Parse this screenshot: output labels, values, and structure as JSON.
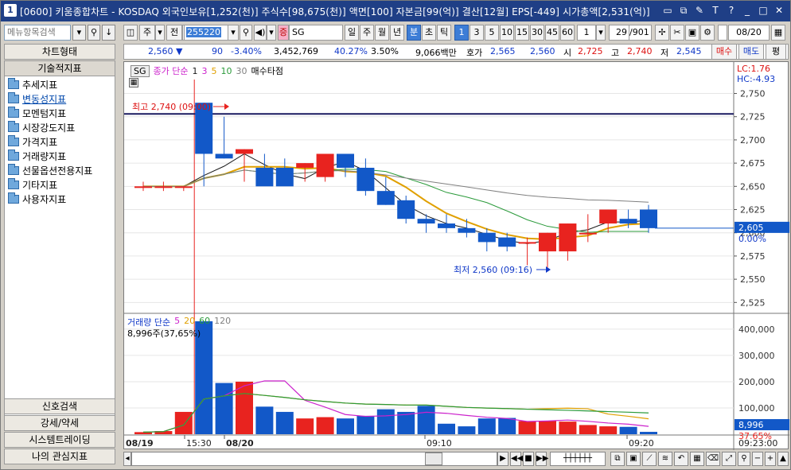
{
  "window": {
    "number": "1",
    "title": "[0600] 키움종합차트 - KOSDAQ 외국인보유[1,252(천)] 주식수[98,675(천)] 액면[100] 자본금[99(억)] 결산[12월] EPS[-449] 시가총액[2,531(억)]"
  },
  "left": {
    "search_placeholder": "메뉴항목검색",
    "chart_type_button": "차트형태",
    "tech_indicator_header": "기술적지표",
    "tree": [
      "추세지표",
      "변동성지표",
      "모멘텀지표",
      "시장강도지표",
      "가격지표",
      "거래량지표",
      "선물옵션전용지표",
      "기타지표",
      "사용자지표"
    ],
    "bottom_buttons": [
      "신호검색",
      "강세/약세",
      "시스템트레이딩",
      "나의 관심지표"
    ]
  },
  "toolbar": {
    "period": "주",
    "prev": "전",
    "code": "255220",
    "stock_name": "SG",
    "intervals": [
      "일",
      "주",
      "월",
      "년",
      "분",
      "초",
      "틱"
    ],
    "selected_interval": "분",
    "minutes": [
      "1",
      "3",
      "5",
      "10",
      "15",
      "30",
      "45",
      "60"
    ],
    "selected_minute": "1",
    "count": "1",
    "page": "29",
    "page_total": "/901",
    "date": "08/20"
  },
  "quote": {
    "price": "2,560 ▼",
    "change": "90",
    "rate": "-3.40%",
    "volume": "3,452,769",
    "vol_ratio": "40.27%",
    "turnover": "3.50%",
    "amount": "9,066백만",
    "ask_label": "호가",
    "ask": "2,565",
    "bid": "2,560",
    "open_label": "시",
    "open": "2,725",
    "high_label": "고",
    "high": "2,740",
    "low_label": "저",
    "low": "2,545",
    "buy": "매수",
    "sell": "매도",
    "flat": "평"
  },
  "legend": {
    "sg": "SG",
    "ma_label": "종가 단순",
    "periods": [
      "1",
      "3",
      "5",
      "10",
      "30"
    ],
    "extra": "매수타점",
    "vol_label": "거래량 단순",
    "vol_periods": [
      "5",
      "20",
      "60",
      "120"
    ],
    "vol_value": "8,996주(37,65%)",
    "lc": "LC:1.76",
    "hc": "HC:-4.93"
  },
  "annotations": {
    "high": "최고 2,740 (09:00)",
    "low": "최저 2,560 (09:16)"
  },
  "axis": {
    "price_ticks": [
      "2,750",
      "2,725",
      "2,700",
      "2,675",
      "2,650",
      "2,625",
      "2,600",
      "2,575",
      "2,550",
      "2,525"
    ],
    "price_marker": "2,605",
    "pct_marker": "0.00%",
    "vol_ticks": [
      "400,000",
      "300,000",
      "200,000",
      "100,000"
    ],
    "vol_marker": "8,996",
    "vol_pct": "37.65%",
    "x_labels": [
      "08/19",
      "15:30",
      "08/20",
      "09:10",
      "09:20",
      "09:23:00"
    ]
  },
  "colors": {
    "up": "#e8231f",
    "down": "#1258c8",
    "ma1": "#1a1a1a",
    "ma5": "#e0a000",
    "ma10": "#2a9a3a",
    "ma30": "#808080",
    "vma5": "#cc22cc",
    "vma20": "#e0a000",
    "vma60": "#2a9a3a",
    "vma120": "#808080"
  },
  "chart_data": {
    "type": "candlestick",
    "x": [
      "15:28",
      "15:29",
      "15:30",
      "09:00",
      "09:01",
      "09:02",
      "09:03",
      "09:04",
      "09:05",
      "09:06",
      "09:07",
      "09:08",
      "09:09",
      "09:10",
      "09:11",
      "09:12",
      "09:13",
      "09:14",
      "09:15",
      "09:16",
      "09:17",
      "09:18",
      "09:19",
      "09:20",
      "09:21",
      "09:22"
    ],
    "open": [
      2650,
      2650,
      2650,
      2740,
      2685,
      2685,
      2670,
      2670,
      2670,
      2660,
      2685,
      2670,
      2645,
      2635,
      2615,
      2610,
      2605,
      2600,
      2595,
      2590,
      2580,
      2580,
      2600,
      2610,
      2615,
      2625
    ],
    "high": [
      2655,
      2655,
      2650,
      2740,
      2725,
      2690,
      2685,
      2680,
      2675,
      2680,
      2685,
      2680,
      2660,
      2640,
      2620,
      2620,
      2615,
      2605,
      2600,
      2595,
      2600,
      2610,
      2620,
      2625,
      2625,
      2630
    ],
    "low": [
      2645,
      2645,
      2645,
      2650,
      2680,
      2655,
      2660,
      2660,
      2655,
      2655,
      2660,
      2640,
      2630,
      2610,
      2600,
      2600,
      2595,
      2580,
      2580,
      2565,
      2560,
      2570,
      2590,
      2600,
      2605,
      2600
    ],
    "close": [
      2650,
      2650,
      2650,
      2685,
      2680,
      2690,
      2650,
      2650,
      2675,
      2685,
      2670,
      2645,
      2630,
      2615,
      2610,
      2605,
      2600,
      2590,
      2585,
      2590,
      2600,
      2610,
      2600,
      2625,
      2610,
      2605
    ],
    "volume": [
      8000,
      12000,
      85000,
      430000,
      195000,
      200000,
      105000,
      85000,
      60000,
      65000,
      60000,
      70000,
      95000,
      85000,
      108000,
      40000,
      30000,
      60000,
      62000,
      50000,
      50000,
      48000,
      35000,
      30000,
      28000,
      9000
    ],
    "ylim": [
      2515,
      2765
    ],
    "vol_ylim": [
      0,
      430000
    ]
  }
}
